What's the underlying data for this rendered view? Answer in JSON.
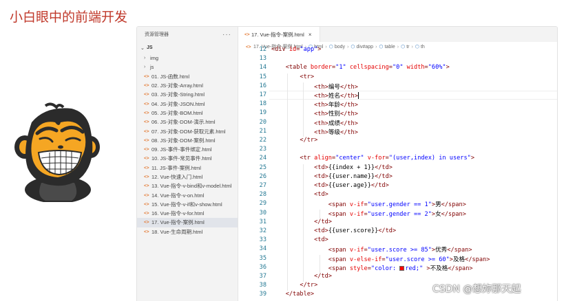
{
  "slide_title": "小白眼中的前端开发",
  "sidebar": {
    "header": "资源管理器",
    "more": "···",
    "root": "JS",
    "folders": [
      "img",
      "js"
    ],
    "files": [
      "01. JS-函数.html",
      "02. JS-对象-Array.html",
      "03. JS-对象-String.html",
      "04. JS-对象-JSON.html",
      "05. JS-对象-BOM.html",
      "06. JS-对象-DOM-演示.html",
      "07. JS-对象-DOM-获取元素.html",
      "08. JS-对象-DOM-案例.html",
      "09. JS-事件-事件绑定.html",
      "10. JS-事件-常见事件.html",
      "11. JS-事件-案例.html",
      "12. Vue-快速入门.html",
      "13. Vue-指令-v-bind和v-model.html",
      "14. Vue-指令-v-on.html",
      "15. Vue-指令-v-if和v-show.html",
      "16. Vue-指令-v-for.html",
      "17. Vue-指令-案例.html",
      "18. Vue-生命周期.html"
    ],
    "active_index": 16
  },
  "tab": {
    "label": "17. Vue-指令-案例.html",
    "close": "×"
  },
  "breadcrumb": [
    "17. Vue-指令-案例.html",
    "html",
    "body",
    "div#app",
    "table",
    "tr",
    "th"
  ],
  "editor": {
    "current_line": 17,
    "lines": [
      {
        "n": "12",
        "code": "<div id=\"app\">"
      },
      {
        "n": "13",
        "code": ""
      },
      {
        "n": "14",
        "code": "    <table border=\"1\" cellspacing=\"0\" width=\"60%\">"
      },
      {
        "n": "15",
        "code": "        <tr>"
      },
      {
        "n": "16",
        "code": "            <th>编号</th>"
      },
      {
        "n": "17",
        "code": "            <th>姓名</th>"
      },
      {
        "n": "18",
        "code": "            <th>年龄</th>"
      },
      {
        "n": "19",
        "code": "            <th>性别</th>"
      },
      {
        "n": "20",
        "code": "            <th>成绩</th>"
      },
      {
        "n": "21",
        "code": "            <th>等级</th>"
      },
      {
        "n": "22",
        "code": "        </tr>"
      },
      {
        "n": "23",
        "code": ""
      },
      {
        "n": "24",
        "code": "        <tr align=\"center\" v-for=\"(user,index) in users\">"
      },
      {
        "n": "25",
        "code": "            <td>{{index + 1}}</td>"
      },
      {
        "n": "26",
        "code": "            <td>{{user.name}}</td>"
      },
      {
        "n": "27",
        "code": "            <td>{{user.age}}</td>"
      },
      {
        "n": "28",
        "code": "            <td>"
      },
      {
        "n": "29",
        "code": "                <span v-if=\"user.gender == 1\">男</span>"
      },
      {
        "n": "30",
        "code": "                <span v-if=\"user.gender == 2\">女</span>"
      },
      {
        "n": "31",
        "code": "            </td>"
      },
      {
        "n": "32",
        "code": "            <td>{{user.score}}</td>"
      },
      {
        "n": "33",
        "code": "            <td>"
      },
      {
        "n": "34",
        "code": "                <span v-if=\"user.score >= 85\">优秀</span>"
      },
      {
        "n": "35",
        "code": "                <span v-else-if=\"user.score >= 60\">及格</span>"
      },
      {
        "n": "36",
        "code": "                <span style=\"color: red;\" v-else>不及格</span>"
      },
      {
        "n": "37",
        "code": "            </td>"
      },
      {
        "n": "38",
        "code": "        </tr>"
      },
      {
        "n": "39",
        "code": "    </table>"
      }
    ]
  },
  "watermark": "CSDN @想妳那天起",
  "colors": {
    "title": "#c0392b",
    "tag": "#800000",
    "attribute": "#e50000",
    "string": "#0000ff",
    "line_number": "#237893",
    "color_swatch": "#ff0000"
  }
}
